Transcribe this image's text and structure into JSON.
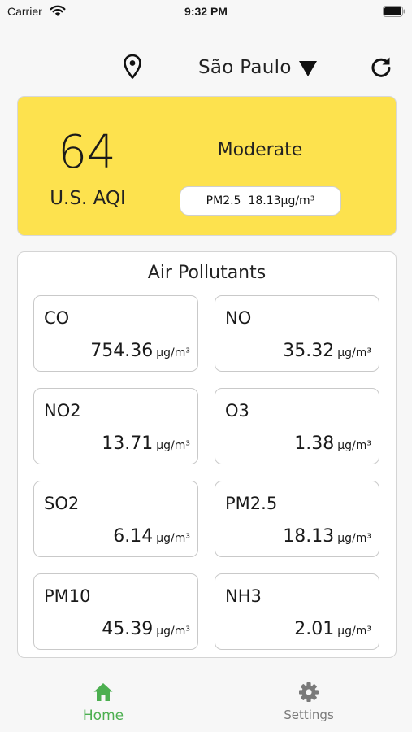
{
  "status_bar": {
    "carrier": "Carrier",
    "time": "9:32 PM"
  },
  "header": {
    "city": "São Paulo",
    "icons": [
      "location-pin-icon",
      "caret-down-icon",
      "refresh-icon"
    ]
  },
  "aqi": {
    "value": "64",
    "label": "U.S. AQI",
    "status": "Moderate",
    "main_pollutant": "PM2.5",
    "main_value": "18.13µg/m³",
    "card_color": "#fde24e"
  },
  "pollutants": {
    "title": "Air Pollutants",
    "unit": "µg/m³",
    "items": [
      {
        "name": "CO",
        "value": "754.36"
      },
      {
        "name": "NO",
        "value": "35.32"
      },
      {
        "name": "NO2",
        "value": "13.71"
      },
      {
        "name": "O3",
        "value": "1.38"
      },
      {
        "name": "SO2",
        "value": "6.14"
      },
      {
        "name": "PM2.5",
        "value": "18.13"
      },
      {
        "name": "PM10",
        "value": "45.39"
      },
      {
        "name": "NH3",
        "value": "2.01"
      }
    ]
  },
  "tabbar": {
    "active_color": "#4caf50",
    "tabs": [
      {
        "label": "Home",
        "icon": "home-icon"
      },
      {
        "label": "Settings",
        "icon": "gear-icon"
      }
    ]
  }
}
